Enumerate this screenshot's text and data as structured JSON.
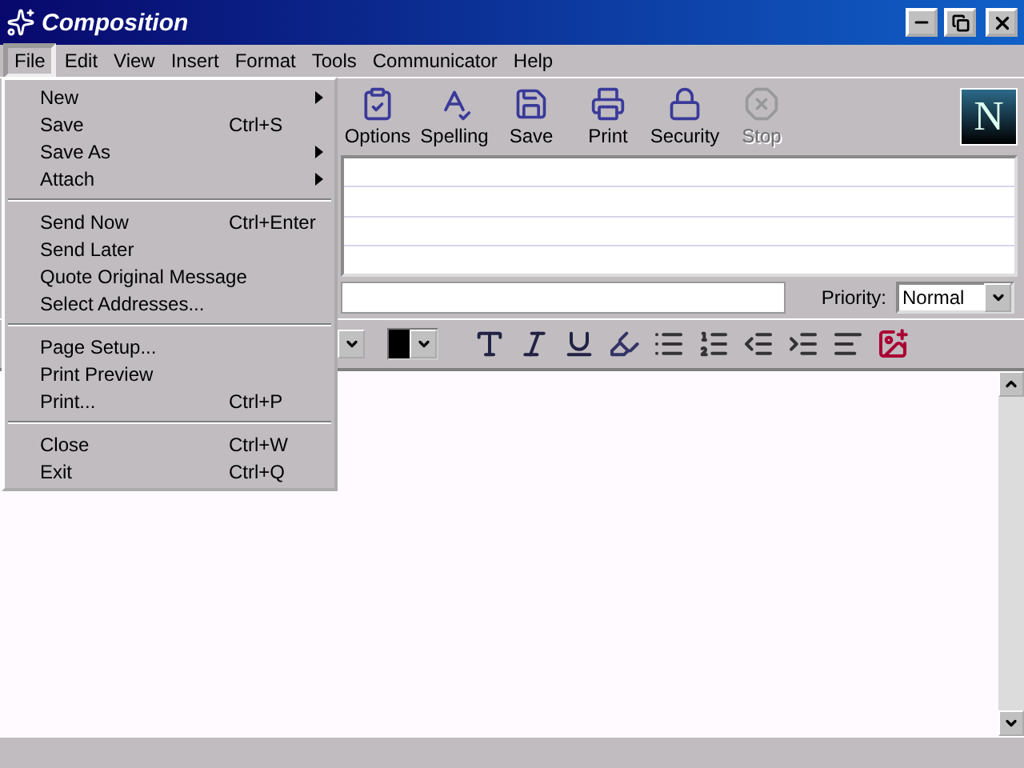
{
  "window": {
    "title": "Composition"
  },
  "menubar": [
    {
      "label": "File",
      "selected": true
    },
    {
      "label": "Edit",
      "selected": false
    },
    {
      "label": "View",
      "selected": false
    },
    {
      "label": "Insert",
      "selected": false
    },
    {
      "label": "Format",
      "selected": false
    },
    {
      "label": "Tools",
      "selected": false
    },
    {
      "label": "Communicator",
      "selected": false
    },
    {
      "label": "Help",
      "selected": false
    }
  ],
  "file_menu": [
    {
      "items": [
        {
          "label": "New",
          "submenu": true
        },
        {
          "label": "Save",
          "shortcut": "Ctrl+S",
          "submenu": false
        },
        {
          "label": "Save As",
          "submenu": true
        },
        {
          "label": "Attach",
          "submenu": true
        }
      ]
    },
    {
      "items": [
        {
          "label": "Send Now",
          "shortcut": "Ctrl+Enter",
          "submenu": false
        },
        {
          "label": "Send Later",
          "submenu": false
        },
        {
          "label": "Quote Original Message",
          "submenu": false
        },
        {
          "label": "Select Addresses...",
          "submenu": false
        }
      ]
    },
    {
      "items": [
        {
          "label": "Page Setup...",
          "submenu": false
        },
        {
          "label": "Print Preview",
          "submenu": false
        },
        {
          "label": "Print...",
          "shortcut": "Ctrl+P",
          "submenu": false
        }
      ]
    },
    {
      "items": [
        {
          "label": "Close",
          "shortcut": "Ctrl+W",
          "submenu": false
        },
        {
          "label": "Exit",
          "shortcut": "Ctrl+Q",
          "submenu": false
        }
      ]
    }
  ],
  "toolbar": [
    {
      "kind": "options",
      "label": "Options",
      "disabled": false
    },
    {
      "kind": "spelling",
      "label": "Spelling",
      "disabled": false
    },
    {
      "kind": "save",
      "label": "Save",
      "disabled": false
    },
    {
      "kind": "print",
      "label": "Print",
      "disabled": false
    },
    {
      "kind": "security",
      "label": "Security",
      "disabled": false
    },
    {
      "kind": "stop",
      "label": "Stop",
      "disabled": true
    }
  ],
  "logo": {
    "letter": "N"
  },
  "priority": {
    "label": "Priority:",
    "value": "Normal"
  }
}
